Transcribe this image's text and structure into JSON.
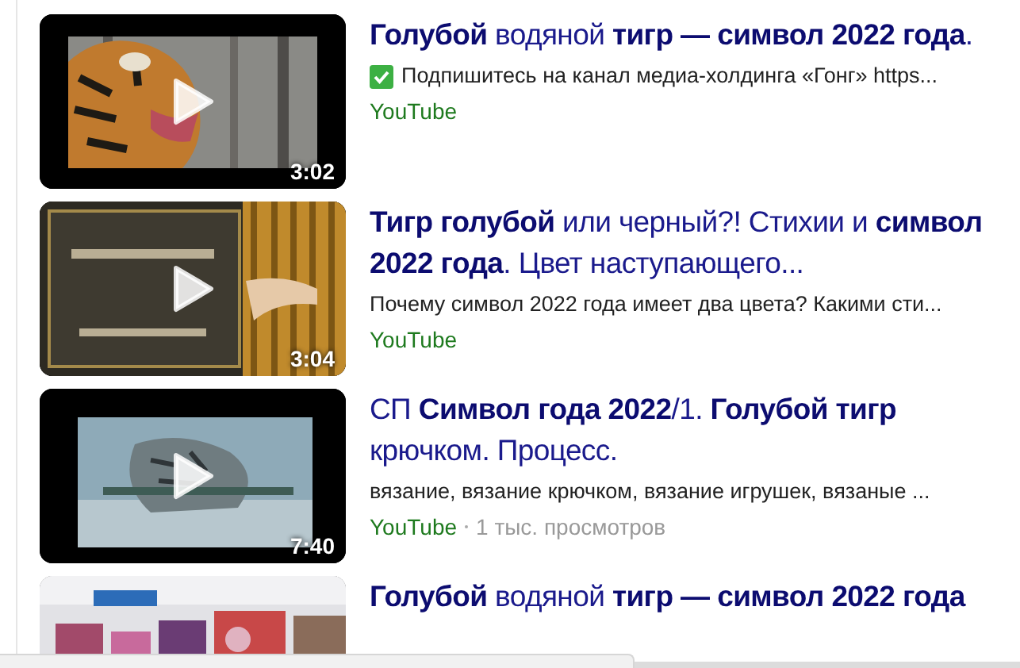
{
  "results": [
    {
      "kind": "picture",
      "duration": "3:02",
      "title": "**Голубой** водяной **тигр — символ 2022 года**.",
      "verified_mark": true,
      "snippet": "Подпишитесь на канал медиа-холдинга «Гонг» https...",
      "source": "YouTube"
    },
    {
      "kind": "picture",
      "duration": "3:04",
      "title": "**Тигр голубой** или черный?! Стихии и **символ 2022 года**. Цвет наступающего...",
      "snippet": "Почему символ 2022 года имеет два цвета? Какими сти...",
      "source": "YouTube"
    },
    {
      "kind": "picture",
      "duration": "7:40",
      "title": "СП **Символ года 2022**/1. **Голубой тигр** крючком. Процесс.",
      "snippet": "вязание, вязание крючком, вязание игрушек, вязаные ...",
      "source": "YouTube",
      "views": "1 тыс. просмотров"
    },
    {
      "kind": "picture",
      "title": "**Голубой** водяной **тигр — символ 2022 года**"
    }
  ]
}
